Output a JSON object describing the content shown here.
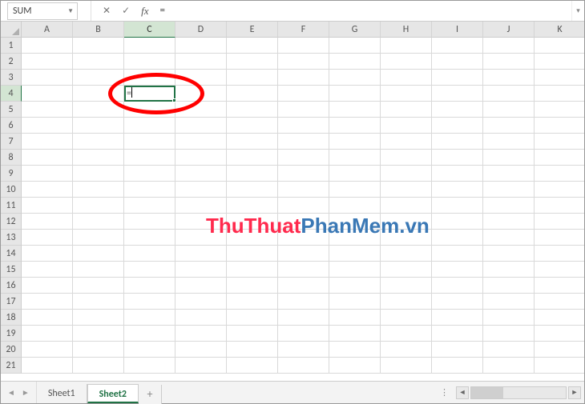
{
  "formula_bar": {
    "name_box_value": "SUM",
    "cancel_tooltip": "Cancel",
    "enter_tooltip": "Enter",
    "fx_label": "fx",
    "formula_text": "="
  },
  "columns": [
    "A",
    "B",
    "C",
    "D",
    "E",
    "F",
    "G",
    "H",
    "I",
    "J",
    "K"
  ],
  "active_column": "C",
  "rows": [
    1,
    2,
    3,
    4,
    5,
    6,
    7,
    8,
    9,
    10,
    11,
    12,
    13,
    14,
    15,
    16,
    17,
    18,
    19,
    20,
    21
  ],
  "active_row": 4,
  "active_cell": {
    "address": "C4",
    "display_value": "="
  },
  "watermark": {
    "part1": "ThuThuat",
    "part2": "PhanMem.vn"
  },
  "sheet_tabs": [
    {
      "name": "Sheet1",
      "active": false
    },
    {
      "name": "Sheet2",
      "active": true
    }
  ],
  "add_sheet_symbol": "+",
  "colors": {
    "excel_green": "#217346",
    "annotation_red": "#ff0000"
  }
}
